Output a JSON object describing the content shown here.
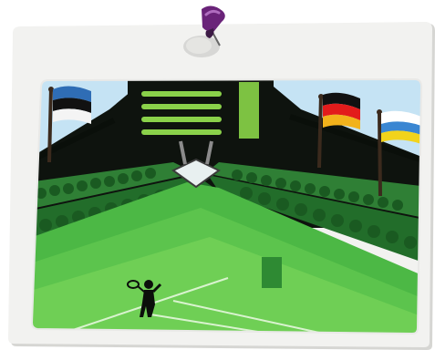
{
  "scene": {
    "card_color": "#f3f3f1",
    "card_shadow": "#d9d9d7",
    "sky_color": "#bfe0f5",
    "stand_color": "#0f150f",
    "crowd_dark": "#1f5b25",
    "crowd_mid": "#2f7a34",
    "field_light": "#5bc24a",
    "field_mid": "#3eaa3a",
    "field_dark": "#2b8f2e",
    "pin_color": "#7b2a8a",
    "flags": [
      {
        "name": "flag-estonia-left",
        "colors": [
          "#2f6db5",
          "#111111",
          "#f4f4f4"
        ]
      },
      {
        "name": "flag-germany",
        "colors": [
          "#111111",
          "#e31b1b",
          "#f2b21b"
        ]
      },
      {
        "name": "flag-ukraine-right",
        "colors": [
          "#ffffff",
          "#3a86d2",
          "#f2d31b"
        ]
      }
    ]
  }
}
